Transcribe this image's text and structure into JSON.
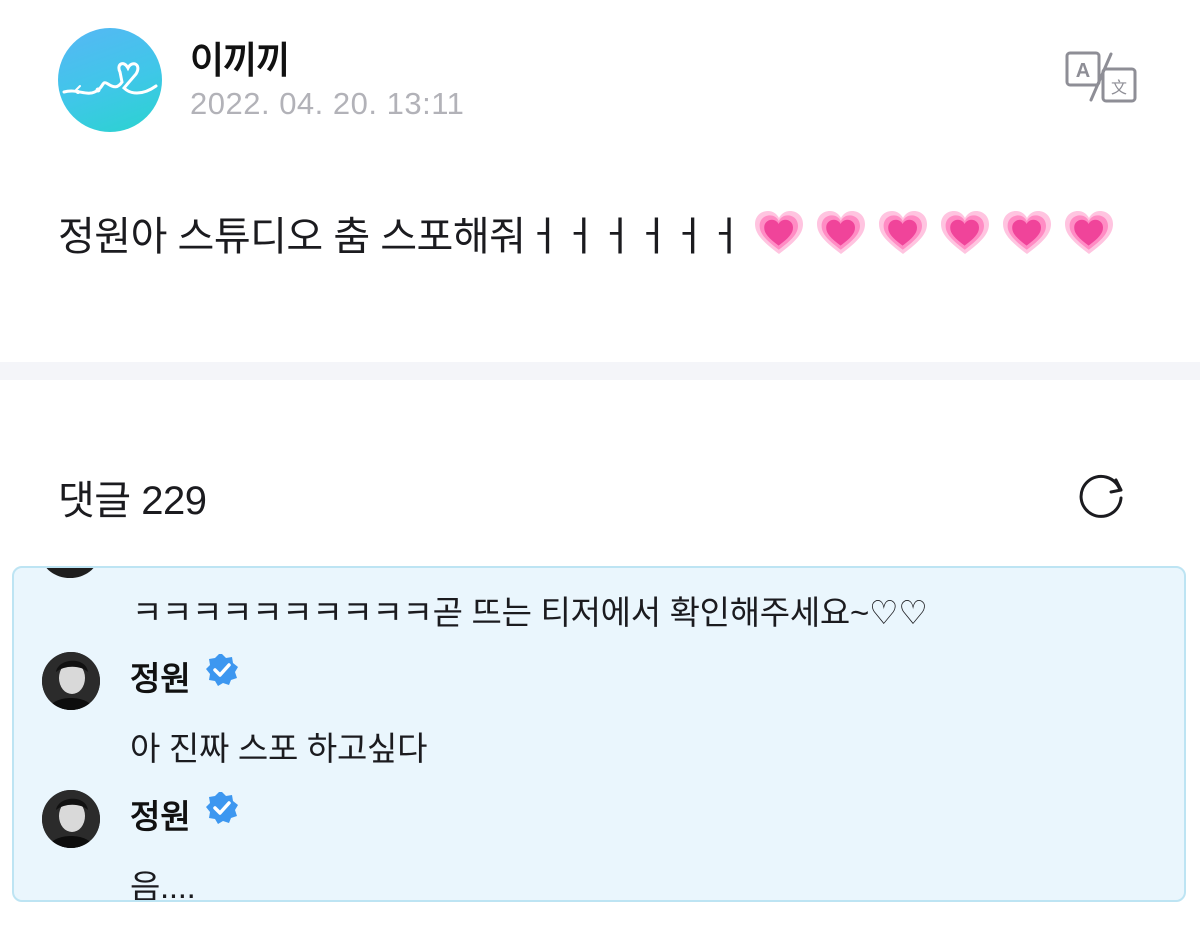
{
  "post": {
    "author": "이끼끼",
    "timestamp": "2022. 04. 20. 13:11",
    "text": "정원아 스튜디오 춤 스포해줘ㅓㅓㅓㅓㅓㅓ",
    "heart_count": 6,
    "heart_icon": "growing-heart-emoji",
    "translate_icon": "translate-icon"
  },
  "comments": {
    "label": "댓글 229",
    "refresh_icon": "refresh-icon",
    "replies": [
      {
        "author": "",
        "text": "ㅋㅋㅋㅋㅋㅋㅋㅋㅋㅋ곧 뜨는 티저에서 확인해주세요~♡♡",
        "verified": false
      },
      {
        "author": "정원",
        "text": "아 진짜 스포 하고싶다",
        "verified": true
      },
      {
        "author": "정원",
        "text": "음....",
        "verified": true
      }
    ]
  },
  "colors": {
    "accent_blue": "#3d97f0",
    "thread_bg": "#eaf6fd",
    "thread_border": "#bde4f3",
    "timestamp_gray": "#b2b2b8",
    "divider": "#f4f5f9",
    "heart_pink": "#f0449a"
  }
}
